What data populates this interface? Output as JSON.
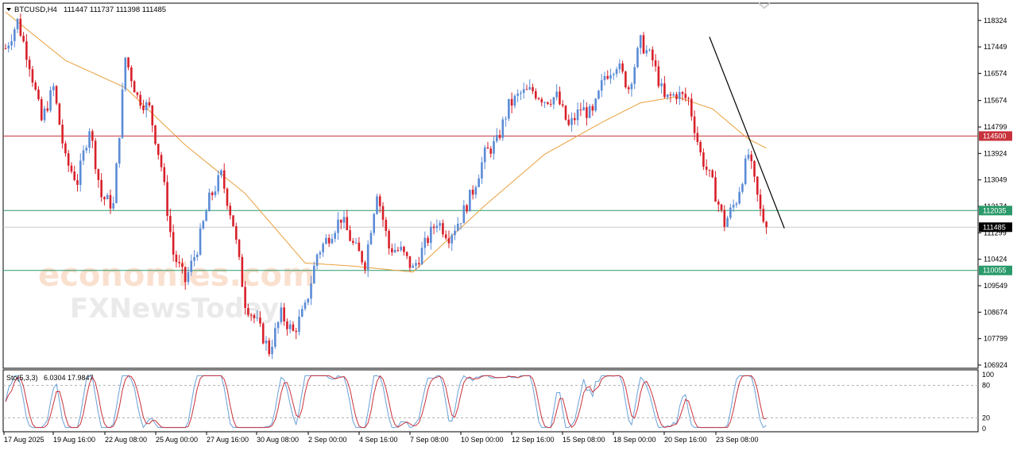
{
  "header": {
    "symbol": "BTCUSD,H4",
    "ohlc": "111447 111737 111398 111485"
  },
  "watermark": {
    "line1": "economies.com",
    "line2": "FXNewsToday"
  },
  "colors": {
    "up": "#5b8bd6",
    "down": "#d8202a",
    "ma": "#e8a03c",
    "resistance": "#c8323c",
    "support": "#2a9a6a",
    "current": "#000000",
    "stoch_main": "#6aa0d8",
    "stoch_signal": "#c8323c"
  },
  "chart_data": [
    {
      "type": "candlestick",
      "symbol": "BTCUSD",
      "timeframe": "H4",
      "ylim": [
        106924,
        119000
      ],
      "yticks": [
        118324,
        117449,
        116574,
        115674,
        114799,
        113924,
        113049,
        112174,
        111299,
        110424,
        109549,
        108674,
        107799,
        106924
      ],
      "xticks": [
        "17 Aug 2025",
        "19 Aug 16:00",
        "22 Aug 08:00",
        "25 Aug 00:00",
        "27 Aug 16:00",
        "30 Aug 08:00",
        "2 Sep 00:00",
        "4 Sep 16:00",
        "7 Sep 08:00",
        "10 Sep 00:00",
        "12 Sep 16:00",
        "15 Sep 08:00",
        "18 Sep 00:00",
        "20 Sep 16:00",
        "23 Sep 08:00"
      ],
      "price_levels": [
        {
          "value": 114500,
          "label": "114500",
          "role": "resistance"
        },
        {
          "value": 112035,
          "label": "112035",
          "role": "support"
        },
        {
          "value": 111485,
          "label": "111485",
          "role": "current"
        },
        {
          "value": 110055,
          "label": "110055",
          "role": "support"
        }
      ],
      "trendline": {
        "from": {
          "index": 235,
          "value": 117780
        },
        "to": {
          "index": 260,
          "value": 111450
        }
      },
      "close_path": [
        [
          0,
          117400
        ],
        [
          4,
          118300
        ],
        [
          8,
          116900
        ],
        [
          12,
          115000
        ],
        [
          16,
          116100
        ],
        [
          20,
          113700
        ],
        [
          24,
          113000
        ],
        [
          28,
          114800
        ],
        [
          32,
          112500
        ],
        [
          36,
          112200
        ],
        [
          40,
          117100
        ],
        [
          44,
          115800
        ],
        [
          48,
          115400
        ],
        [
          52,
          113500
        ],
        [
          56,
          110600
        ],
        [
          60,
          109700
        ],
        [
          64,
          110800
        ],
        [
          68,
          112400
        ],
        [
          72,
          113200
        ],
        [
          76,
          111600
        ],
        [
          80,
          109000
        ],
        [
          84,
          108300
        ],
        [
          88,
          107400
        ],
        [
          92,
          108600
        ],
        [
          96,
          108000
        ],
        [
          100,
          108800
        ],
        [
          104,
          110600
        ],
        [
          108,
          111200
        ],
        [
          112,
          111800
        ],
        [
          116,
          110900
        ],
        [
          120,
          110300
        ],
        [
          124,
          112700
        ],
        [
          128,
          110800
        ],
        [
          132,
          110700
        ],
        [
          136,
          110100
        ],
        [
          140,
          110900
        ],
        [
          144,
          111700
        ],
        [
          148,
          111200
        ],
        [
          152,
          111800
        ],
        [
          156,
          112700
        ],
        [
          160,
          113900
        ],
        [
          164,
          114300
        ],
        [
          168,
          115500
        ],
        [
          172,
          115900
        ],
        [
          176,
          116000
        ],
        [
          180,
          115700
        ],
        [
          184,
          115800
        ],
        [
          188,
          114800
        ],
        [
          192,
          115400
        ],
        [
          196,
          115200
        ],
        [
          200,
          116500
        ],
        [
          204,
          116900
        ],
        [
          208,
          116100
        ],
        [
          212,
          117600
        ],
        [
          216,
          117000
        ],
        [
          220,
          115700
        ],
        [
          224,
          115900
        ],
        [
          228,
          115700
        ],
        [
          232,
          113900
        ],
        [
          236,
          112900
        ],
        [
          240,
          111600
        ],
        [
          244,
          112400
        ],
        [
          248,
          113900
        ],
        [
          252,
          112000
        ],
        [
          254,
          111485
        ]
      ],
      "moving_average": [
        [
          0,
          118600
        ],
        [
          20,
          117000
        ],
        [
          40,
          116100
        ],
        [
          60,
          114200
        ],
        [
          80,
          112600
        ],
        [
          100,
          110300
        ],
        [
          116,
          110200
        ],
        [
          136,
          110000
        ],
        [
          160,
          112200
        ],
        [
          180,
          113900
        ],
        [
          200,
          115000
        ],
        [
          212,
          115600
        ],
        [
          224,
          115800
        ],
        [
          236,
          115400
        ],
        [
          248,
          114400
        ],
        [
          254,
          114100
        ]
      ],
      "candle_count": 255
    },
    {
      "type": "line",
      "indicator": "Sto(5,3,3)",
      "values_label": "6.0304 17.9847",
      "series": [
        {
          "name": "main",
          "last": 6.0304
        },
        {
          "name": "signal",
          "last": 17.9847
        }
      ],
      "ylim": [
        0,
        100
      ],
      "yticks": [
        100,
        80,
        20,
        0
      ],
      "levels": [
        80,
        20
      ]
    }
  ]
}
